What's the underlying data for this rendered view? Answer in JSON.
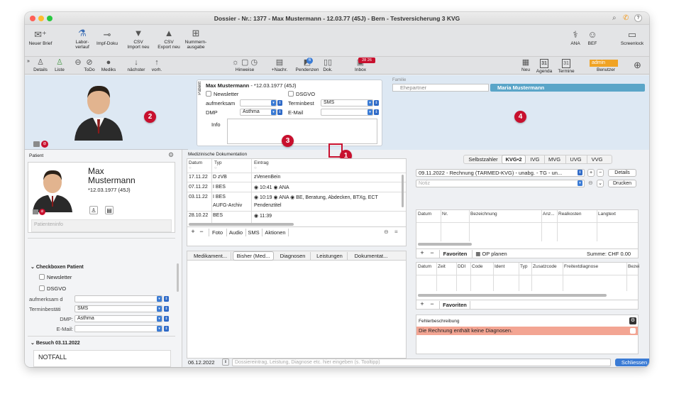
{
  "window": {
    "title": "Dossier - Nr.: 1377 - Max Mustermann - 12.03.77 (45J) - Bern - Testversicherung 3 KVG"
  },
  "toolbar1": {
    "neuer_brief": "Neuer Brief",
    "labor1": "Labor-",
    "labor2": "verlauf",
    "impf": "Impf-Doku",
    "csv_import1": "CSV",
    "csv_import2": "Import neu",
    "csv_export1": "CSV",
    "csv_export2": "Export neu",
    "nummern1": "Nummern-",
    "nummern2": "ausgabe",
    "ana": "ANA",
    "bef": "BEF",
    "screenlock": "Screenlock"
  },
  "toolbar2": {
    "details": "Details",
    "liste": "Liste",
    "todo": "ToDo",
    "mediks": "Mediks",
    "naechster": "nächster",
    "vorh": "vorh.",
    "hinweise": "Hinweise",
    "nachr": "+Nachr.",
    "pendenzen": "Pendenzen",
    "dok": "Dok.",
    "inbox": "Inbox",
    "pendenzen_badge": "6",
    "inbox_badge": "28 26",
    "neu": "Neu",
    "agenda": "Agenda",
    "termine": "Termine",
    "agenda_day": "31",
    "termine_day": "31",
    "user": "admin",
    "benutzer": "Benutzer"
  },
  "patient_card": {
    "vlabel": "Patient",
    "name_line": "Max Mustermann",
    "dob_line": " - *12.03.1977 (45J)",
    "newsletter": "Newsletter",
    "dsgvo": "DSGVO",
    "aufmerksam": "aufmerksam",
    "terminbest": "Terminbest",
    "terminbest_val": "SMS",
    "dmp": "DMP",
    "dmp_val": "Asthma",
    "email": "E-Mail",
    "info": "Info"
  },
  "familie": {
    "label": "Familie",
    "role": "Ehepartner",
    "person": "Maria Mustermann"
  },
  "badges": {
    "b1": "1",
    "b2": "2",
    "b3": "3",
    "b4": "4"
  },
  "sidebar": {
    "title": "Patient",
    "first": "Max",
    "last": "Mustermann",
    "dob": "*12.03.1977 (45J)",
    "info_placeholder": "Patienteninfo",
    "checkbox_section": "Checkboxen Patient",
    "newsletter": "Newsletter",
    "dsgvo": "DSGVO",
    "aufmerksam": "aufmerksam d",
    "terminbest": "Terminbestäti",
    "terminbest_val": "SMS",
    "dmp": "DMP:",
    "dmp_val": "Asthma",
    "email": "E-Mail:",
    "besuch": "Besuch 03.11.2022",
    "notfall": "NOTFALL"
  },
  "meddoc": {
    "title": "Medizinische Dokumentation",
    "col_datum": "Datum",
    "col_typ": "Typ",
    "col_eintrag": "Eintrag",
    "rows": [
      {
        "datum": "17.11.22",
        "typ": "D zVB",
        "eintrag": "zVenenBein"
      },
      {
        "datum": "07.11.22",
        "typ": "I BES",
        "eintrag": "◉ 10:41 ◉ ANA"
      },
      {
        "datum": "03.11.22",
        "typ": "I BES",
        "eintrag": "◉ 10:19 ◉ ANA ◉ BE, Beratung, Abdecken, BTXg, ECT"
      },
      {
        "datum": "",
        "typ": "AUFG-Archiv",
        "eintrag": "Pendenztitel"
      },
      {
        "datum": "28.10.22",
        "typ": "BES",
        "eintrag": "◉ 11:39"
      }
    ],
    "foto": "Foto",
    "audio": "Audio",
    "sms": "SMS",
    "aktionen": "Aktionen"
  },
  "medtabs": {
    "t1": "Medikament...",
    "t2": "Bisher (Med...",
    "t3": "Diagnosen",
    "t4": "Leistungen",
    "t5": "Dokumentat..."
  },
  "billing": {
    "tabs": [
      "Selbstzahler",
      "KVG•2",
      "IVG",
      "MVG",
      "UVG",
      "VVG"
    ],
    "rechnung": "09.11.2022 - Rechnung (TARMED-KVG) - unabg. - TG - un...",
    "details": "Details",
    "notiz": "Notiz",
    "drucken": "Drucken",
    "cols1": {
      "datum": "Datum",
      "nr": "Nr.",
      "bez": "Bezeichnung",
      "anz": "Anz...",
      "real": "Realkosten",
      "lang": "Langtext"
    },
    "favoriten": "Favoriten",
    "op_planen": "OP planen",
    "summe": "Summe: CHF 0.00",
    "cols2": {
      "datum": "Datum",
      "zeit": "Zeit",
      "ddi": "DDI",
      "code": "Code",
      "ident": "Ident",
      "typ": "Typ",
      "zusatz": "Zusatzcode",
      "frei": "Freitextdiagnose",
      "bez": "Bezei"
    },
    "favoriten2": "Favoriten",
    "fehler_label": "Fehlerbeschreibung",
    "fehler_msg": "Die Rechnung enthält keine Diagnosen."
  },
  "bottom": {
    "date": "06.12.2022",
    "placeholder": "Dossiereintrag, Leistung, Diagnose etc. hier eingeben (s. Tooltipp)",
    "schliessen": "Schliessen"
  },
  "colors": {
    "accent": "#3a7bd5",
    "badge": "#c8102e",
    "familie_active": "#5aa5c8",
    "error": "#f3a593",
    "admin": "#f0a324"
  }
}
